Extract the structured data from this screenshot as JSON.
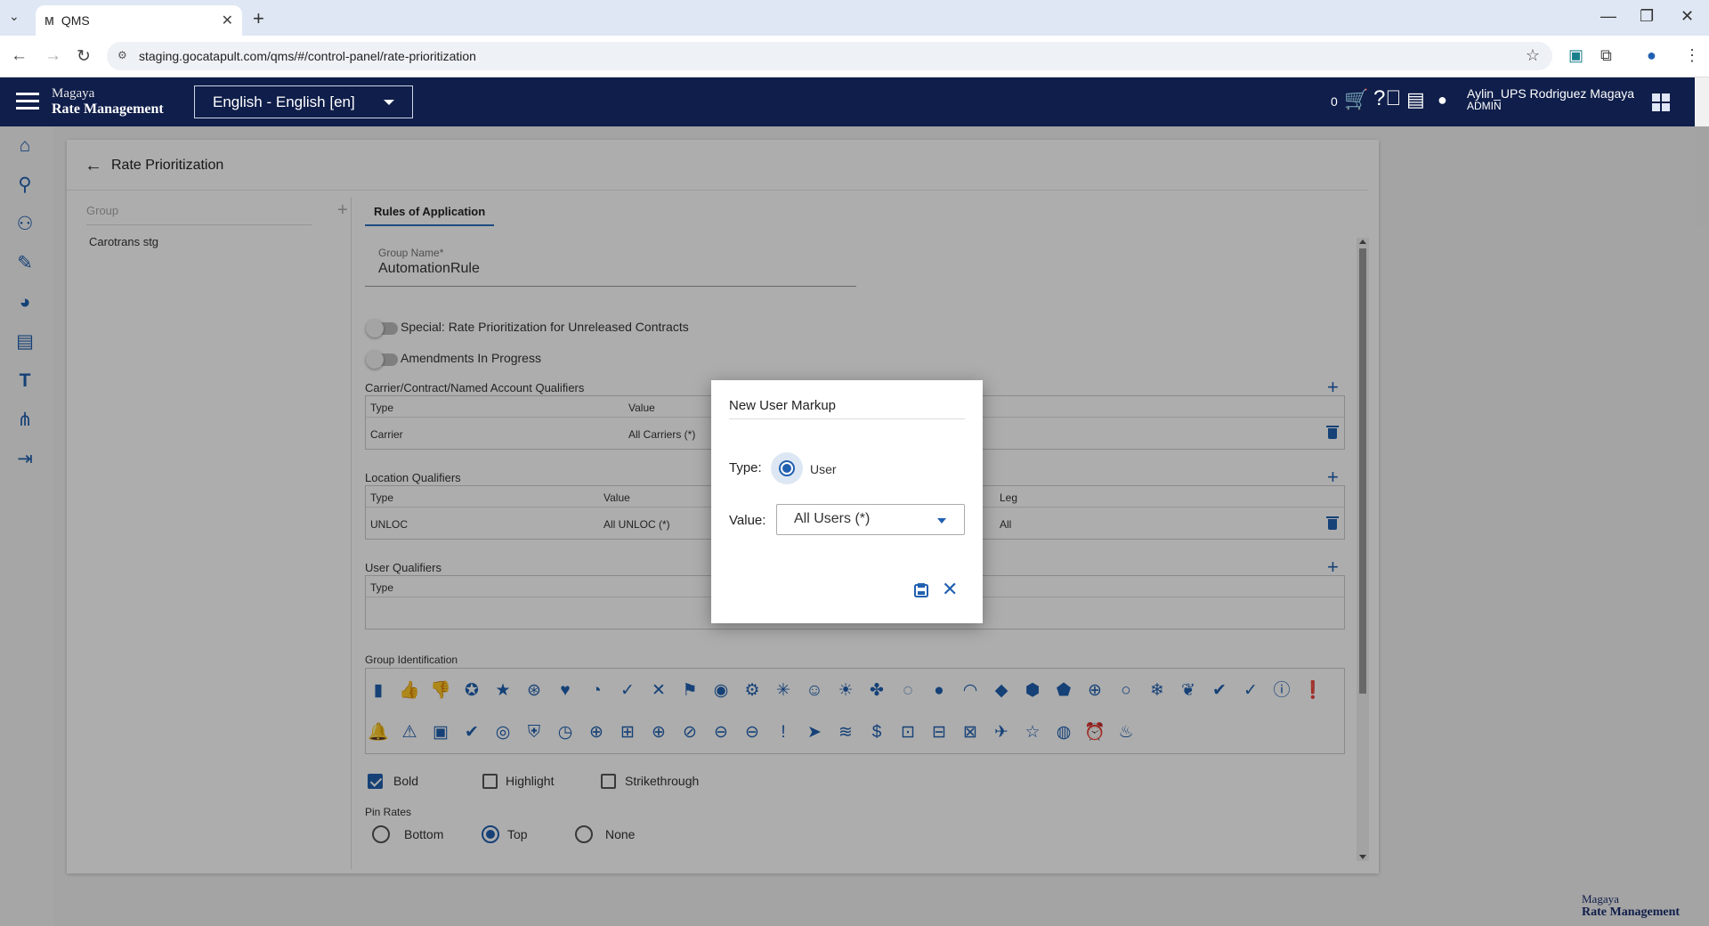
{
  "browser": {
    "tab_title": "QMS",
    "tab_favicon": "M",
    "url": "staging.gocatapult.com/qms/#/control-panel/rate-prioritization"
  },
  "header": {
    "brand_line1": "Magaya",
    "brand_line2": "Rate Management",
    "language": "English - English [en]",
    "cart_count": "0",
    "user_name": "Aylin_UPS Rodriguez Magaya",
    "user_role": "ADMIN",
    "bg_color": "#0f1e4a"
  },
  "sidebar_icons": [
    "home-icon",
    "search-icon",
    "users-icon",
    "edit-document-icon",
    "pie-chart-icon",
    "chat-icon",
    "text-icon",
    "network-icon",
    "import-icon"
  ],
  "page": {
    "title": "Rate Prioritization",
    "group_header": "Group",
    "group_items": [
      "Carotrans stg"
    ],
    "tab_label": "Rules of Application",
    "group_name_label": "Group Name*",
    "group_name_value": "AutomationRule",
    "toggle_special": "Special: Rate Prioritization for Unreleased Contracts",
    "toggle_amendments": "Amendments In Progress",
    "carrier_section": {
      "title": "Carrier/Contract/Named Account Qualifiers",
      "columns": [
        "Type",
        "Value"
      ],
      "rows": [
        [
          "Carrier",
          "All Carriers (*)"
        ]
      ]
    },
    "location_section": {
      "title": "Location Qualifiers",
      "columns": [
        "Type",
        "Value",
        "Leg"
      ],
      "rows": [
        [
          "UNLOC",
          "All UNLOC (*)",
          "All"
        ]
      ]
    },
    "user_section": {
      "title": "User Qualifiers",
      "columns": [
        "Type"
      ]
    },
    "group_identification_title": "Group Identification",
    "group_icons_row1": [
      "bookmark-icon",
      "thumb-up-icon",
      "thumb-down-icon",
      "star-circle-icon",
      "star-icon",
      "dots-circle-icon",
      "heart-icon",
      "pie-icon",
      "check-icon",
      "close-icon",
      "flag-icon",
      "target-icon",
      "gear-icon",
      "sparkle-icon",
      "smile-icon",
      "sun-icon",
      "fan-icon",
      "dashed-circle-icon",
      "circle-icon",
      "arc-icon",
      "wallet-icon",
      "badge-icon",
      "tag-icon",
      "crosshair-icon",
      "ring-icon",
      "snowflake-icon",
      "sprout-icon",
      "double-check-icon",
      "double-check-thin-icon",
      "alert-outline-icon",
      "alert-circle-icon"
    ],
    "group_icons_row2": [
      "warning-bell-icon",
      "warning-icon",
      "clipboard-check-icon",
      "check-circle-icon",
      "check-circle-outline-icon",
      "shield-check-icon",
      "clock-icon",
      "plus-circle-icon",
      "plus-box-icon",
      "plus-circle-outline-icon",
      "block-icon",
      "minus-circle-icon",
      "minus-circle-outline-icon",
      "exclamation-circle-icon",
      "send-icon",
      "waves-icon",
      "dollar-icon",
      "bus-clock-icon",
      "bus-icon",
      "train-icon",
      "airplane-icon",
      "star-outline-icon",
      "globe-icon",
      "alarm-icon",
      "fire-icon"
    ],
    "style_options": [
      {
        "label": "Bold",
        "checked": true
      },
      {
        "label": "Highlight",
        "checked": false
      },
      {
        "label": "Strikethrough",
        "checked": false
      }
    ],
    "pin_rates_title": "Pin Rates",
    "pin_options": [
      {
        "label": "Bottom",
        "selected": false
      },
      {
        "label": "Top",
        "selected": true
      },
      {
        "label": "None",
        "selected": false
      }
    ],
    "accent_color": "#2060b0"
  },
  "dialog": {
    "title": "New User Markup",
    "type_label": "Type:",
    "type_option": "User",
    "value_label": "Value:",
    "value_selected": "All Users (*)"
  },
  "footer": {
    "brand_line1": "Magaya",
    "brand_line2": "Rate Management"
  }
}
